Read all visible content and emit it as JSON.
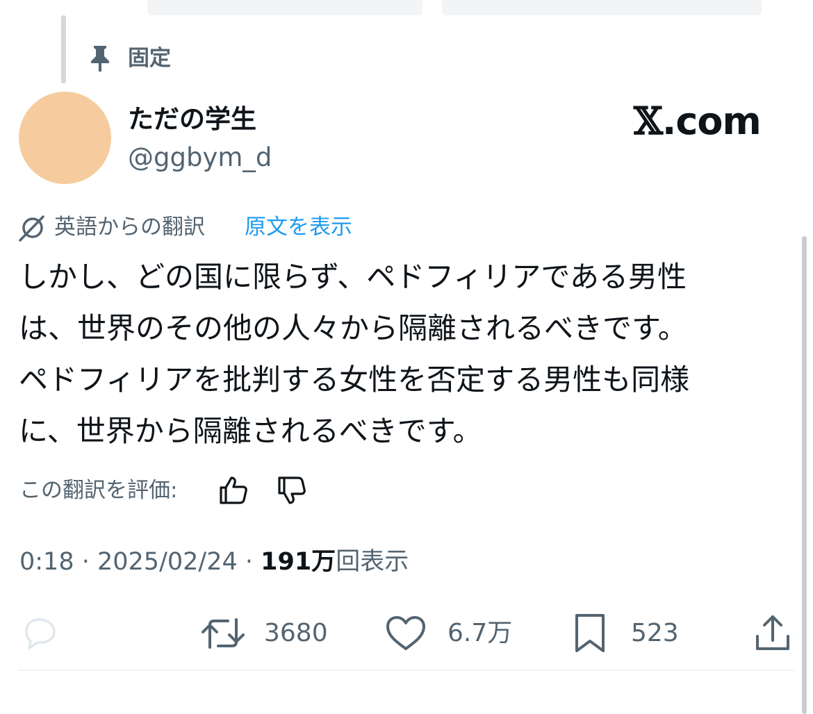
{
  "pinned": {
    "icon": "pin-icon",
    "label": "固定"
  },
  "author": {
    "display_name": "ただの学生",
    "handle": "@ggbym_d",
    "avatar_color": "#f6cc9f"
  },
  "watermark": {
    "x": "𝕏",
    "domain": ".com"
  },
  "translation": {
    "icon": "translate-icon",
    "translated_from": "英語からの翻訳",
    "show_original": "原文を表示"
  },
  "tweet": {
    "lines": [
      "しかし、どの国に限らず、ペドフィリアである男性",
      "は、世界のその他の人々から隔離されるべきです。",
      "ペドフィリアを批判する女性を否定する男性も同様",
      "に、世界から隔離されるべきです。"
    ]
  },
  "rating": {
    "label": "この翻訳を評価:",
    "up_icon": "thumbs-up-icon",
    "down_icon": "thumbs-down-icon"
  },
  "meta": {
    "time": "0:18",
    "separator": " · ",
    "date": "2025/02/24",
    "views_count": "191万",
    "views_label": "回表示"
  },
  "actions": {
    "reply_icon": "reply-icon",
    "retweet_count": "3680",
    "like_count": "6.7万",
    "bookmark_count": "523",
    "share_icon": "share-icon"
  },
  "colors": {
    "accent": "#1d9bf0",
    "muted": "#536471",
    "text": "#0f1419"
  }
}
